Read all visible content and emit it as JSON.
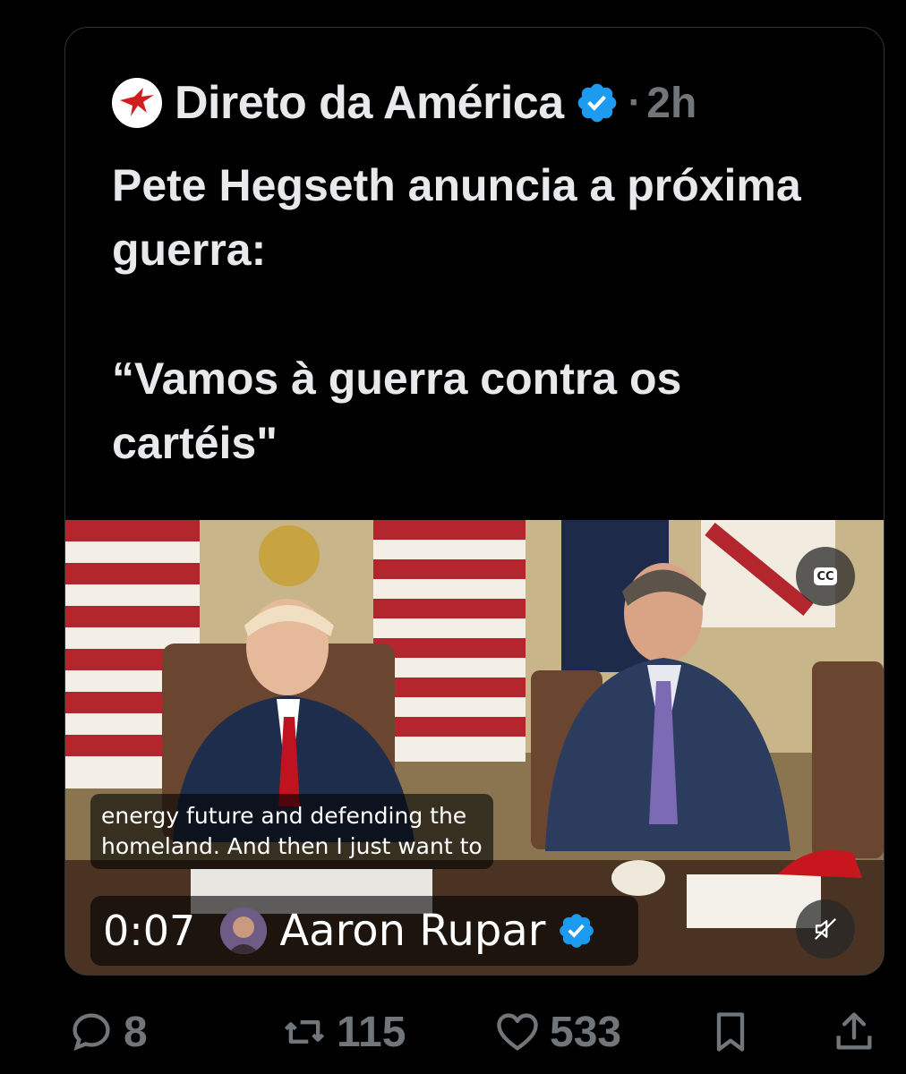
{
  "tweet": {
    "author": "Direto da América",
    "separator": "·",
    "time": "2h",
    "text": "Pete Hegseth anuncia a próxima guerra:\n\n“Vamos à guerra contra os cartéis\""
  },
  "media": {
    "cc_label": "CC",
    "caption": "energy future and defending the\nhomeland. And then I just want to",
    "timer": "0:07",
    "video_author": "Aaron Rupar"
  },
  "actions": {
    "replies": "8",
    "reposts": "115",
    "likes": "533"
  },
  "colors": {
    "verified": "#1d9bf0",
    "muted_text": "#71767b",
    "text": "#e7e9ea"
  }
}
